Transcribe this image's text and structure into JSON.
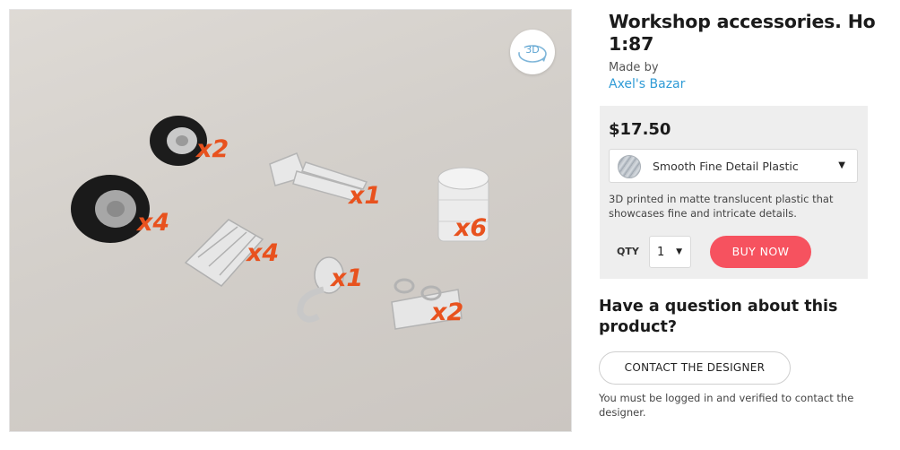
{
  "product": {
    "title": "Workshop accessories. Ho 1:87",
    "made_by_label": "Made by",
    "designer_name": "Axel's Bazar"
  },
  "photo": {
    "view_3d_label": "3D",
    "quantity_tags": [
      "x2",
      "x1",
      "x4",
      "x6",
      "x4",
      "x1",
      "x2"
    ]
  },
  "purchase": {
    "price": "$17.50",
    "material": {
      "selected": "Smooth Fine Detail Plastic",
      "description": "3D printed in matte translucent plastic that showcases fine and intricate details."
    },
    "qty_label": "QTY",
    "qty_value": "1",
    "buy_label": "BUY NOW"
  },
  "contact": {
    "question": "Have a question about this product?",
    "button_label": "CONTACT THE DESIGNER",
    "note": "You must be logged in and verified to contact the designer."
  },
  "icons": {
    "dropdown": "caret-down-icon",
    "view_3d": "rotate-3d-icon"
  },
  "colors": {
    "buy_button": "#f6525f",
    "link": "#2f9bd6",
    "panel_bg": "#eeeeee",
    "quantity_tag": "#e8521e"
  }
}
